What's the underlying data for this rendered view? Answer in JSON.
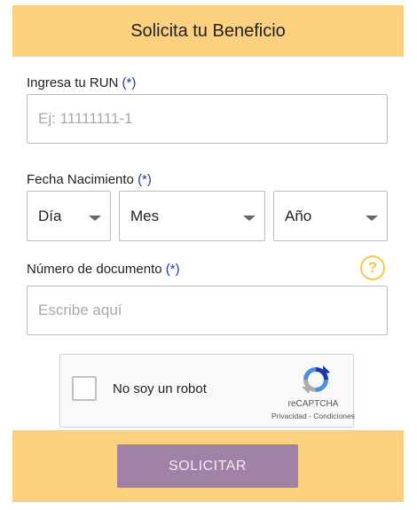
{
  "header": {
    "title": "Solicita tu Beneficio"
  },
  "run": {
    "label": "Ingresa tu RUN",
    "required_mark": "(*)",
    "placeholder": "Ej: 11111111-1",
    "value": ""
  },
  "birthdate": {
    "label": "Fecha Nacimiento",
    "required_mark": "(*)",
    "day": "Día",
    "month": "Mes",
    "year": "Año"
  },
  "document": {
    "label": "Número de documento",
    "required_mark": "(*)",
    "placeholder": "Escribe aquí",
    "value": "",
    "help_icon": "?"
  },
  "captcha": {
    "label": "No soy un robot",
    "brand": "reCAPTCHA",
    "links": "Privacidad - Condiciones",
    "checked": false
  },
  "footer": {
    "submit_label": "SOLICITAR"
  },
  "colors": {
    "accent": "#fbd180",
    "button": "#a182a7",
    "required": "#1f3a93",
    "help": "#f3c74c"
  },
  "icons": [
    "chevron-down-icon",
    "help-circle-icon",
    "recaptcha-logo-icon"
  ]
}
